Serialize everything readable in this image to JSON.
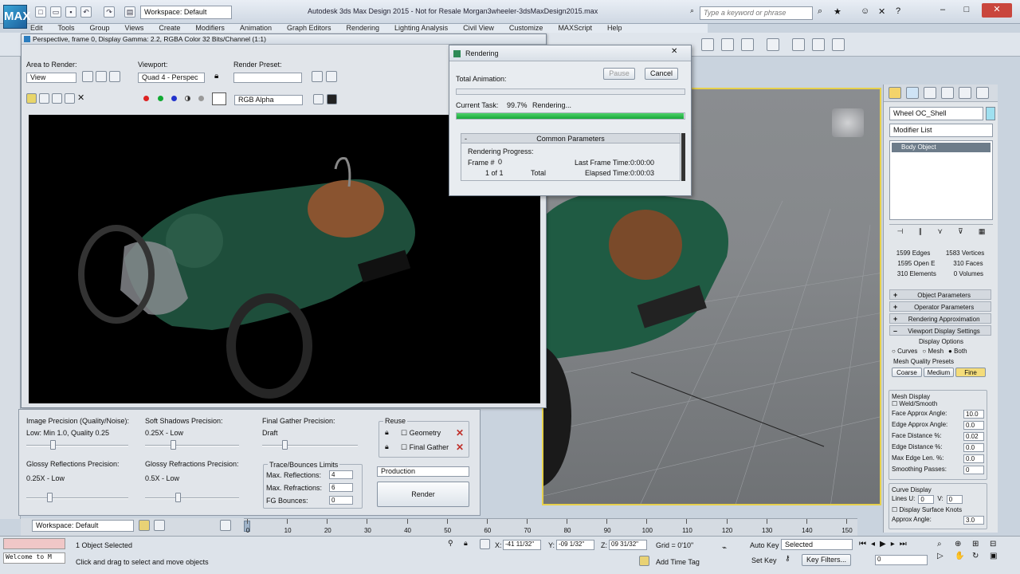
{
  "app": {
    "title": "Autodesk 3ds Max Design 2015 - Not for Resale  Morgan3wheeler-3dsMaxDesign2015.max",
    "workspace": "Workspace: Default",
    "search_placeholder": "Type a keyword or phrase",
    "logo": "MAX"
  },
  "menu": [
    "Edit",
    "Tools",
    "Group",
    "Views",
    "Create",
    "Modifiers",
    "Animation",
    "Graph Editors",
    "Rendering",
    "Lighting Analysis",
    "Civil View",
    "Customize",
    "MAXScript",
    "Help"
  ],
  "frame_window": {
    "title": "Perspective, frame 0, Display Gamma: 2.2, RGBA Color 32 Bits/Channel (1:1)",
    "area_label": "Area to Render:",
    "area_value": "View",
    "viewport_label": "Viewport:",
    "viewport_value": "Quad 4 - Perspec",
    "preset_label": "Render Preset:",
    "preset_value": "",
    "channel_value": "RGB Alpha"
  },
  "settings": {
    "img_prec_label": "Image Precision (Quality/Noise):",
    "img_prec_value": "Low: Min 1.0, Quality 0.25",
    "soft_label": "Soft Shadows Precision:",
    "soft_value": "0.25X - Low",
    "fg_label": "Final Gather Precision:",
    "fg_value": "Draft",
    "gloss_refl_label": "Glossy Reflections Precision:",
    "gloss_refl_value": "0.25X - Low",
    "gloss_refr_label": "Glossy Refractions Precision:",
    "gloss_refr_value": "0.5X - Low",
    "trace_label": "Trace/Bounces Limits",
    "max_refl_label": "Max. Reflections:",
    "max_refl_value": "4",
    "max_refr_label": "Max. Refractions:",
    "max_refr_value": "6",
    "fg_bounces_label": "FG Bounces:",
    "fg_bounces_value": "0",
    "reuse_label": "Reuse",
    "geometry_label": "Geometry",
    "final_gather_label": "Final Gather",
    "production_value": "Production",
    "render_label": "Render"
  },
  "render_dialog": {
    "title": "Rendering",
    "pause": "Pause",
    "cancel": "Cancel",
    "total_label": "Total Animation:",
    "task_label": "Current Task:",
    "task_pct": "99.7%",
    "task_text": "Rendering...",
    "task_progress": 0.997,
    "common": "Common Parameters",
    "progress_group": "Rendering Progress:",
    "frame_label": "Frame #",
    "frame_value": "0",
    "count_value": "1 of 1",
    "total": "Total",
    "last_frame_label": "Last Frame Time:",
    "last_frame_value": "0:00:00",
    "elapsed_label": "Elapsed Time:",
    "elapsed_value": "0:00:03"
  },
  "command_panel": {
    "object_name": "Wheel OC_Shell",
    "modifier_list": "Modifier List",
    "stack_item": "Body Object",
    "edges": "1599 Edges",
    "verts": "1583 Vertices",
    "open_e": "1595 Open E",
    "faces": "310 Faces",
    "elements": "310 Elements",
    "volumes": "0 Volumes",
    "rollouts": [
      "Object Parameters",
      "Operator Parameters",
      "Rendering Approximation",
      "Viewport Display Settings"
    ],
    "display_options": "Display Options",
    "curves": "Curves",
    "mesh": "Mesh",
    "both": "Both",
    "presets_label": "Mesh Quality Presets",
    "coarse": "Coarse",
    "medium": "Medium",
    "fine": "Fine",
    "mesh_display": "Mesh Display",
    "weld_smooth": "Weld/Smooth",
    "face_angle_label": "Face Approx Angle:",
    "face_angle_value": "10.0",
    "edge_angle_label": "Edge Approx Angle:",
    "edge_angle_value": "0.0",
    "face_dist_label": "Face Distance %:",
    "face_dist_value": "0.02",
    "edge_dist_label": "Edge Distance %:",
    "edge_dist_value": "0.0",
    "max_edge_label": "Max Edge Len. %:",
    "max_edge_value": "0.0",
    "smoothing_label": "Smoothing Passes:",
    "smoothing_value": "0",
    "curve_display": "Curve Display",
    "lines_u_label": "Lines U:",
    "lines_u_value": "0",
    "lines_v_label": "V:",
    "lines_v_value": "0",
    "surface_knots": "Display Surface Knots",
    "approx_angle_label": "Approx Angle:",
    "approx_angle_value": "3.0"
  },
  "timeline": {
    "ticks": [
      "0",
      "10",
      "20",
      "30",
      "40",
      "50",
      "60",
      "70",
      "80",
      "90",
      "100",
      "110",
      "120",
      "130",
      "140",
      "150"
    ]
  },
  "status": {
    "workspace": "Workspace: Default",
    "listener": "Welcome to M",
    "selected": "1 Object Selected",
    "prompt": "Click and drag to select and move objects",
    "x_label": "X:",
    "x_value": "-41 11/32\"",
    "y_label": "Y:",
    "y_value": "-09 1/32\"",
    "z_label": "Z:",
    "z_value": "09 31/32\"",
    "grid": "Grid = 0'10\"",
    "auto_key": "Auto Key",
    "set_key": "Set Key",
    "key_selected": "Selected",
    "key_filters": "Key Filters...",
    "add_time_tag": "Add Time Tag",
    "frame_value": "0"
  }
}
